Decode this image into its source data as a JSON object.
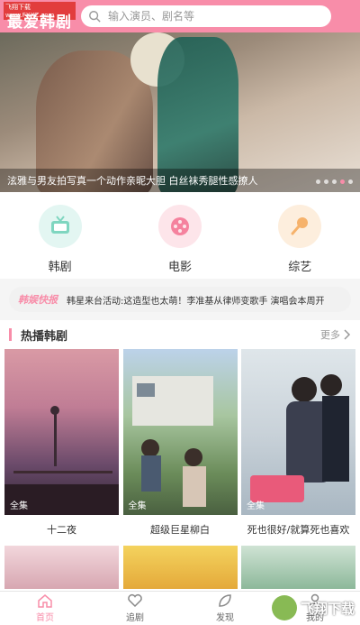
{
  "header": {
    "logo_text": "最爱韩剧",
    "logo_badge": "飞翔下载 www.FXXZ.com",
    "search_placeholder": "输入演员、剧名等"
  },
  "banner": {
    "caption": "泫雅与男友拍写真一个动作亲昵大胆 白丝袜秀腿性感撩人",
    "slide_count": 5,
    "active_slide": 3
  },
  "categories": [
    {
      "label": "韩剧",
      "icon": "tv-icon"
    },
    {
      "label": "电影",
      "icon": "film-reel-icon"
    },
    {
      "label": "综艺",
      "icon": "microphone-icon"
    }
  ],
  "news": {
    "tag": "韩娱快报",
    "text": "韩星来台活动:这造型也太萌！李准基从律师变歌手 演唱会本周开"
  },
  "section": {
    "title": "热播韩剧",
    "more": "更多"
  },
  "cards": [
    {
      "title": "十二夜",
      "tag": "全集"
    },
    {
      "title": "超级巨星柳白",
      "tag": "全集"
    },
    {
      "title": "死也很好/就算死也喜欢",
      "tag": "全集"
    }
  ],
  "tabs": [
    {
      "label": "首页",
      "icon": "home-icon",
      "active": true
    },
    {
      "label": "追剧",
      "icon": "heart-icon",
      "active": false
    },
    {
      "label": "发现",
      "icon": "leaf-icon",
      "active": false
    },
    {
      "label": "我的",
      "icon": "user-icon",
      "active": false
    }
  ],
  "watermark": "飞翔下载",
  "colors": {
    "accent": "#f88da9"
  }
}
